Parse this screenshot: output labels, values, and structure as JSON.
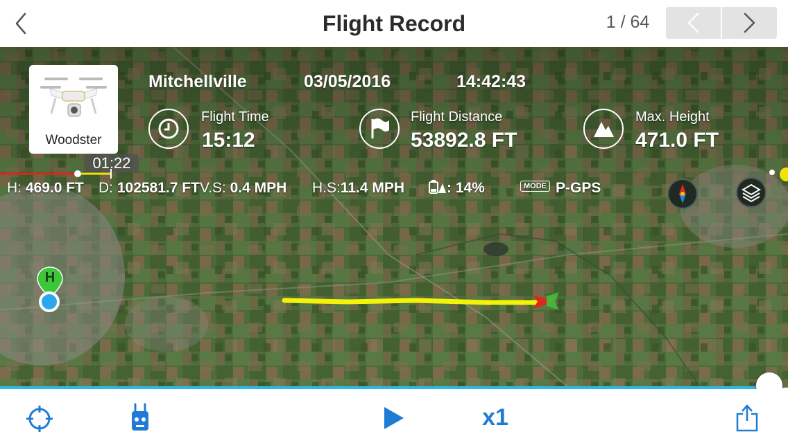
{
  "header": {
    "title": "Flight Record",
    "counter": "1 / 64"
  },
  "drone": {
    "name": "Woodster"
  },
  "flight_info": {
    "location": "Mitchellville",
    "date": "03/05/2016",
    "time": "14:42:43"
  },
  "stats": [
    {
      "label": "Flight Time",
      "value": "15:12",
      "icon": "clock-icon"
    },
    {
      "label": "Flight Distance",
      "value": "53892.8 FT",
      "icon": "flag-icon"
    },
    {
      "label": "Max. Height",
      "value": "471.0 FT",
      "icon": "mountain-icon"
    }
  ],
  "playback": {
    "elapsed": "01:22",
    "speed": "x1",
    "progress": 0.98
  },
  "telemetry": {
    "h_label": "H:",
    "h_value": "469.0 FT",
    "d_label": "D:",
    "d_value": "102581.7 FT",
    "vs_label": "V.S:",
    "vs_value": "0.4 MPH",
    "hs_label": "H.S:",
    "hs_value": "11.4 MPH",
    "battery_value": ": 14%",
    "mode_badge": "MODE",
    "mode_value": "P-GPS"
  },
  "map": {
    "home_marker": "H"
  },
  "colors": {
    "accent": "#1F7BD4",
    "progress": "#2BB9E8",
    "flight_path": "#F2F20A",
    "home_marker": "#3CC73A",
    "aircraft_arrow": "#E0261C"
  }
}
